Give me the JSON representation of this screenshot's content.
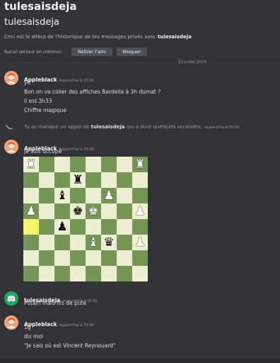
{
  "header": {
    "title": "tulesaisdeja",
    "subtitle": "tulesaisdeja",
    "intro_prefix": "Ceci est le début de l'historique de tes messages privés avec ",
    "intro_user": "tulesaisdeja",
    "intro_suffix": ".",
    "mutual": "Aucun serveur en commun",
    "remove_friend": "Retirer l'ami",
    "block": "Bloquer"
  },
  "date_divider": "12 juillet 2024",
  "messages": [
    {
      "author": "Appleblack",
      "timestamp": "Aujourd'hui à 03:32",
      "lines": [
        "yo",
        "Bon on va coller des affiches Bardella à 3h dumat ?",
        "il est 3h33",
        "Chiffre magique"
      ]
    },
    {
      "author": "Appleblack",
      "timestamp": "Aujourd'hui à 03:39",
      "lines": [
        "je suis occupé"
      ]
    },
    {
      "author": "tulesaisdeja",
      "timestamp": "Aujourd'hui à 03:39",
      "lines": [
        "Putain mais fils de pute"
      ]
    },
    {
      "author": "Appleblack",
      "timestamp": "Aujourd'hui à 03:40",
      "lines": [
        "1g",
        "dis moi",
        "\"Je sais où est Vincent Reynouard\""
      ]
    }
  ],
  "call": {
    "prefix": "Tu as manqué un appel de ",
    "user": "tulesaisdeja",
    "suffix": " qui a duré quelques secondes.",
    "timestamp": "Aujourd'hui à 03:39"
  },
  "chess": {
    "highlight": [
      [
        4,
        0
      ]
    ],
    "board": [
      [
        "wR",
        "",
        "",
        "",
        "",
        "",
        "wR",
        ""
      ],
      [
        "",
        "",
        "",
        "bK_rook",
        "",
        "",
        "",
        ""
      ],
      [
        "",
        "",
        "wB_black",
        "",
        "",
        "wP",
        "",
        ""
      ],
      [
        "",
        "",
        "",
        "",
        "",
        "",
        "",
        ""
      ],
      [
        "",
        "",
        "",
        "",
        "",
        "",
        "",
        ""
      ],
      [
        "",
        "",
        "",
        "",
        "",
        "",
        "",
        ""
      ],
      [
        "",
        "",
        "",
        "",
        "",
        "",
        "",
        ""
      ],
      [
        "",
        "",
        "",
        "",
        "",
        "",
        "",
        ""
      ]
    ],
    "pieces": [
      {
        "r": 0,
        "c": 0,
        "p": "♜",
        "side": "w"
      },
      {
        "r": 0,
        "c": 7,
        "p": "♜",
        "side": "w"
      },
      {
        "r": 1,
        "c": 3,
        "p": "♜",
        "side": "b"
      },
      {
        "r": 2,
        "c": 2,
        "p": "♝",
        "side": "b"
      },
      {
        "r": 2,
        "c": 5,
        "p": "♟",
        "side": "w"
      },
      {
        "r": 3,
        "c": 0,
        "p": "♟",
        "side": "w"
      },
      {
        "r": 3,
        "c": 3,
        "p": "♚",
        "side": "b"
      },
      {
        "r": 3,
        "c": 4,
        "p": "♚",
        "side": "w"
      },
      {
        "r": 3,
        "c": 7,
        "p": "♟",
        "side": "w"
      },
      {
        "r": 4,
        "c": 2,
        "p": "♟",
        "side": "b"
      },
      {
        "r": 5,
        "c": 4,
        "p": "♝",
        "side": "w"
      },
      {
        "r": 5,
        "c": 5,
        "p": "♛",
        "side": "b"
      },
      {
        "r": 5,
        "c": 7,
        "p": "♟",
        "side": "w"
      }
    ]
  }
}
